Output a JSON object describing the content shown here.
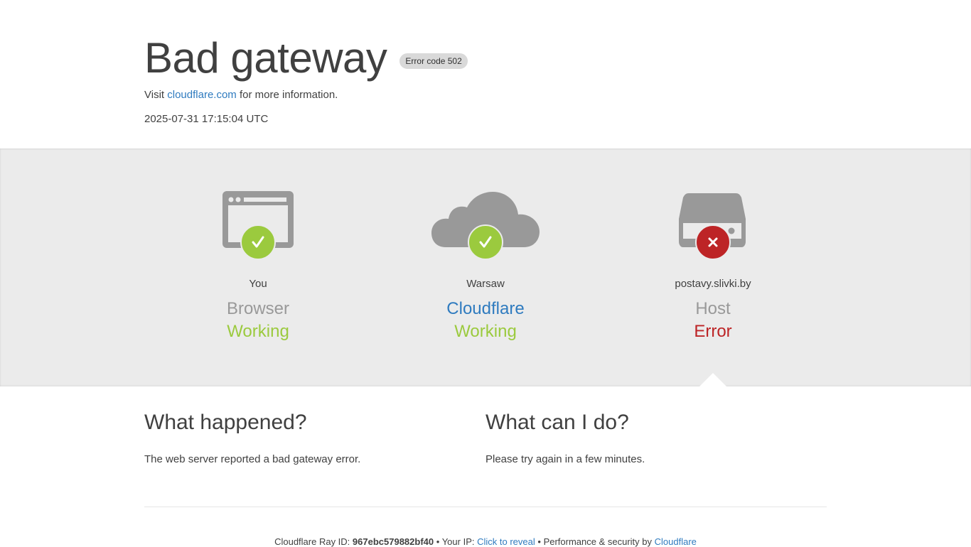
{
  "header": {
    "title": "Bad gateway",
    "error_badge": "Error code 502",
    "visit_prefix": "Visit",
    "visit_link": "cloudflare.com",
    "visit_suffix": "for more information.",
    "timestamp": "2025-07-31 17:15:04 UTC"
  },
  "status": [
    {
      "location": "You",
      "kind": "Browser",
      "state": "Working",
      "icon": "browser-icon",
      "status_icon": "check-icon"
    },
    {
      "location": "Warsaw",
      "kind": "Cloudflare",
      "state": "Working",
      "icon": "cloud-icon",
      "status_icon": "check-icon"
    },
    {
      "location": "postavy.slivki.by",
      "kind": "Host",
      "state": "Error",
      "icon": "server-icon",
      "status_icon": "close-icon"
    }
  ],
  "what_happened": {
    "title": "What happened?",
    "text": "The web server reported a bad gateway error."
  },
  "what_can_i_do": {
    "title": "What can I do?",
    "text": "Please try again in a few minutes."
  },
  "footer": {
    "ray_label": "Cloudflare Ray ID:",
    "ray_id": "967ebc579882bf40",
    "sep1": "•",
    "ip_label": "Your IP:",
    "ip_link": "Click to reveal",
    "sep2": "•",
    "perf_label": "Performance & security by",
    "perf_link": "Cloudflare"
  },
  "colors": {
    "ok": "#9bca3e",
    "error": "#bd2426",
    "link": "#2f7bbf",
    "icon_gray": "#999999"
  }
}
